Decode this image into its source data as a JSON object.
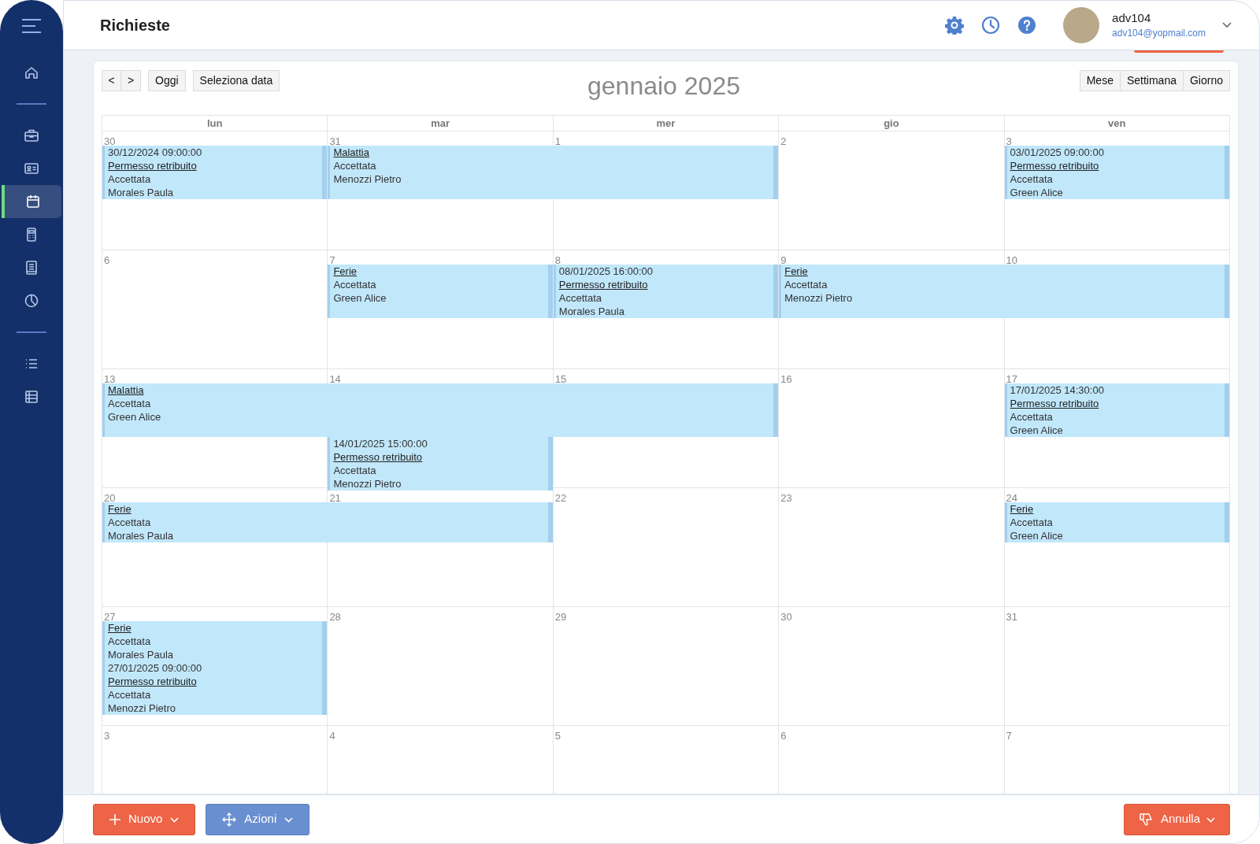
{
  "sidebar": {
    "menu": {
      "selected": false
    },
    "groups": [
      [
        {
          "selected": false
        }
      ],
      [
        {
          "selected": false
        },
        {
          "selected": false
        },
        {
          "selected": true
        },
        {
          "selected": false
        },
        {
          "selected": false
        },
        {
          "selected": false
        }
      ],
      [
        {
          "selected": false
        },
        {
          "selected": false
        }
      ]
    ]
  },
  "header": {
    "title": "Richieste",
    "user": {
      "name": "adv104",
      "email": "adv104@yopmail.com"
    }
  },
  "toolbar": {
    "nav": [
      "<",
      ">"
    ],
    "today": "Oggi",
    "pick_date": "Seleziona data",
    "month_title": "gennaio 2025",
    "views": [
      {
        "label": "Mese",
        "selected": false
      },
      {
        "label": "Settimana",
        "selected": false
      },
      {
        "label": "Giorno",
        "selected": false
      }
    ]
  },
  "calendar": {
    "weekdays": [
      "lun",
      "mar",
      "mer",
      "gio",
      "ven"
    ],
    "weeks": [
      {
        "days": [
          "30",
          "31",
          "1",
          "2",
          "3"
        ],
        "lanes": [
          [
            {
              "kind": "event",
              "time": "30/12/2024 09:00:00",
              "type": "Permesso retribuito",
              "status": "Accettata",
              "person": "Morales Paula"
            },
            {
              "kind": "event",
              "type": "Malattia",
              "status": "Accettata",
              "person": "Menozzi Pietro"
            },
            {
              "kind": "continued"
            },
            {
              "kind": "gap"
            },
            {
              "kind": "event",
              "time": "03/01/2025 09:00:00",
              "type": "Permesso retribuito",
              "status": "Accettata",
              "person": "Green Alice"
            }
          ]
        ]
      },
      {
        "days": [
          "6",
          "7",
          "8",
          "9",
          "10"
        ],
        "lanes": [
          [
            {
              "kind": "gap"
            },
            {
              "kind": "event",
              "type": "Ferie",
              "status": "Accettata",
              "person": "Green Alice"
            },
            {
              "kind": "event",
              "time": "08/01/2025 16:00:00",
              "type": "Permesso retribuito",
              "status": "Accettata",
              "person": "Morales Paula"
            },
            {
              "kind": "event",
              "type": "Ferie",
              "status": "Accettata",
              "person": "Menozzi Pietro"
            },
            {
              "kind": "continued"
            }
          ]
        ]
      },
      {
        "days": [
          "13",
          "14",
          "15",
          "16",
          "17"
        ],
        "lanes": [
          [
            {
              "kind": "event",
              "type": "Malattia",
              "status": "Accettata",
              "person": "Green Alice"
            },
            {
              "kind": "continued"
            },
            {
              "kind": "continued"
            },
            {
              "kind": "gap"
            },
            {
              "kind": "event",
              "time": "17/01/2025 14:30:00",
              "type": "Permesso retribuito",
              "status": "Accettata",
              "person": "Green Alice"
            }
          ],
          [
            {
              "kind": "gap"
            },
            {
              "kind": "event",
              "time": "14/01/2025 15:00:00",
              "type": "Permesso retribuito",
              "status": "Accettata",
              "person": "Menozzi Pietro"
            },
            {
              "kind": "gap"
            },
            {
              "kind": "gap"
            },
            {
              "kind": "gap"
            }
          ]
        ]
      },
      {
        "days": [
          "20",
          "21",
          "22",
          "23",
          "24"
        ],
        "lanes": [
          [
            {
              "kind": "event",
              "type": "Ferie",
              "status": "Accettata",
              "person": "Morales Paula"
            },
            {
              "kind": "continued"
            },
            {
              "kind": "gap"
            },
            {
              "kind": "gap"
            },
            {
              "kind": "event",
              "type": "Ferie",
              "status": "Accettata",
              "person": "Green Alice"
            }
          ]
        ]
      },
      {
        "days": [
          "27",
          "28",
          "29",
          "30",
          "31"
        ],
        "lanes": [
          [
            {
              "kind": "event",
              "type": "Ferie",
              "status": "Accettata",
              "person": "Morales Paula"
            },
            {
              "kind": "gap"
            },
            {
              "kind": "gap"
            },
            {
              "kind": "gap"
            },
            {
              "kind": "gap"
            }
          ],
          [
            {
              "kind": "event",
              "time": "27/01/2025 09:00:00",
              "type": "Permesso retribuito",
              "status": "Accettata",
              "person": "Menozzi Pietro"
            },
            {
              "kind": "gap"
            },
            {
              "kind": "gap"
            },
            {
              "kind": "gap"
            },
            {
              "kind": "gap"
            }
          ]
        ]
      },
      {
        "days": [
          "3",
          "4",
          "5",
          "6",
          "7"
        ]
      }
    ]
  },
  "footer": {
    "new_button": "Nuovo",
    "actions_button": "Azioni",
    "cancel_button": "Annulla"
  }
}
